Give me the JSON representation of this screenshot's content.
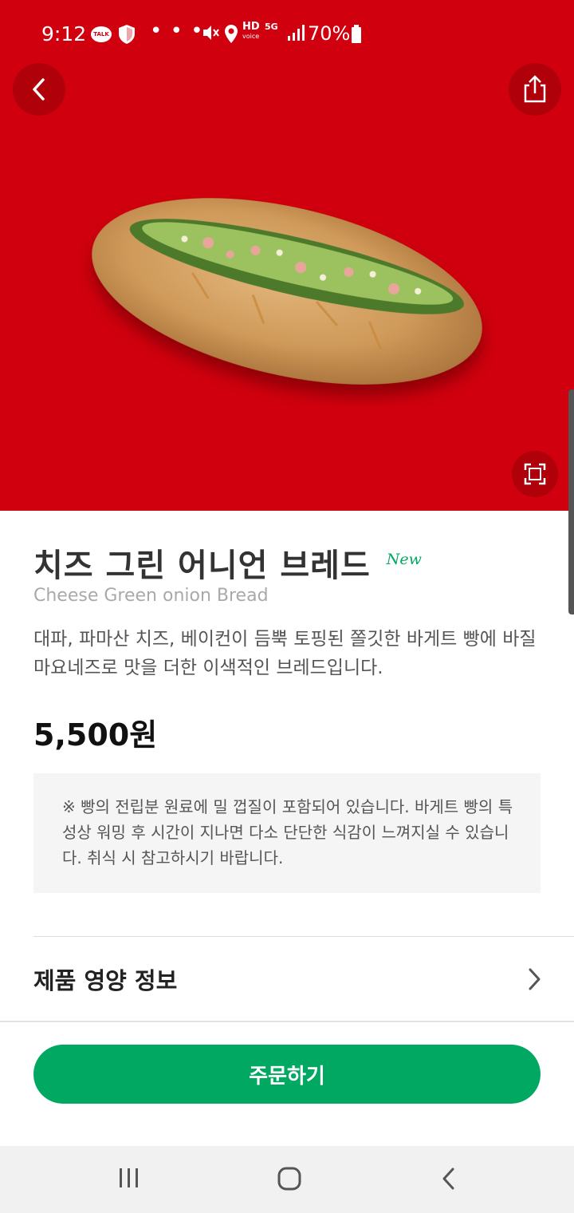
{
  "status_bar": {
    "time": "9:12",
    "talk_badge": "TALK",
    "overflow_dots": "• • •",
    "hd_label": "HD",
    "voice_label": "voice",
    "network": "5G",
    "battery_percent": "70%"
  },
  "hero": {
    "background_color": "#d1000e",
    "image_icon": "cheese-green-onion-bread-image"
  },
  "product": {
    "name_ko": "치즈 그린 어니언 브레드",
    "badge": "New",
    "name_en": "Cheese Green onion Bread",
    "description": "대파, 파마산 치즈, 베이컨이 듬뿍 토핑된 쫄깃한 바게트 빵에 바질 마요네즈로 맛을 더한 이색적인 브레드입니다.",
    "price": "5,500원",
    "notice": "※ 빵의 전립분 원료에 밀 껍질이 포함되어 있습니다. 바게트 빵의 특성상 워밍 후 시간이 지나면 다소 단단한 식감이 느껴지실 수 있습니다. 취식 시 참고하시기 바랍니다."
  },
  "nutrition": {
    "label": "제품 영양 정보"
  },
  "order_button": {
    "label": "주문하기",
    "color": "#00a862"
  },
  "icons": {
    "back": "chevron-left-icon",
    "share": "share-icon",
    "zoom": "fullscreen-icon",
    "nav_recents": "recents-icon",
    "nav_home": "home-icon",
    "nav_back": "back-icon"
  }
}
